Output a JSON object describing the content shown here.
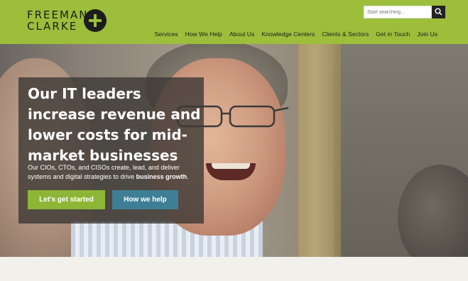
{
  "header": {
    "logo": {
      "line1": "FREEMAN",
      "line2": "CLARKE"
    },
    "search": {
      "placeholder": "Start searching..."
    },
    "nav": [
      "Services",
      "How We Help",
      "About Us",
      "Knowledge Centers",
      "Clients & Sectors",
      "Get in Touch",
      "Join Us"
    ]
  },
  "hero": {
    "headline": "Our IT leaders increase revenue and lower costs for mid-market businesses",
    "subtext_prefix": "Our CIOs, CTOs, and CISOs create, lead, and deliver systems and digital strategies to drive ",
    "subtext_bold": "business growth",
    "subtext_suffix": ".",
    "primary_button": "Let's get started",
    "secondary_button": "How we help"
  },
  "colors": {
    "brand_green": "#9cbe3b",
    "button_green": "#8db637",
    "button_blue": "#3e7f96",
    "dark": "#1d1d1b"
  }
}
